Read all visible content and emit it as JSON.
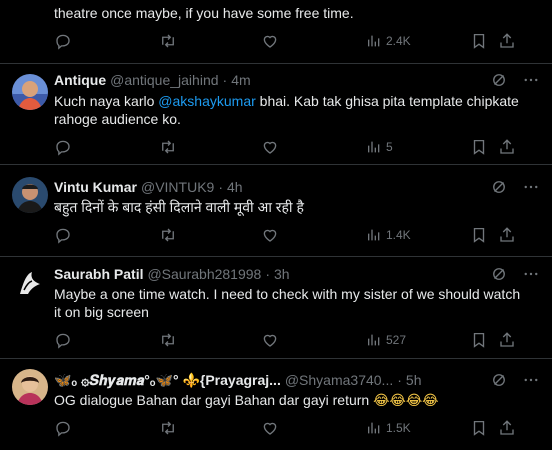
{
  "tweets": [
    {
      "text": "theatre once maybe, if you have some free time.",
      "views": "2.4K"
    },
    {
      "name": "Antique",
      "handle": "@antique_jaihind",
      "time": "4m",
      "text_pre": "Kuch naya karlo ",
      "mention": "@akshaykumar",
      "text_post": " bhai. Kab tak ghisa pita template chipkate",
      "text_line2": "rahoge audience ko.",
      "views": "5"
    },
    {
      "name": "Vintu Kumar",
      "handle": "@VINTUK9",
      "time": "4h",
      "text": "बहुत दिनों के बाद हंसी दिलाने वाली मूवी आ रही है",
      "views": "1.4K"
    },
    {
      "name": "Saurabh Patil",
      "handle": "@Saurabh281998",
      "time": "3h",
      "text_line1": "Maybe a one time watch. I need to check with my sister of we should watch",
      "text_line2": "it on big screen",
      "views": "527"
    },
    {
      "name": "🦋ₒ ۞𝑺𝒉𝒚𝒂𝒎𝒂°ₒ🦋°  ⚜️{Prayagraj...",
      "handle": "@Shyama3740...",
      "time": "5h",
      "text": "OG dialogue Bahan dar gayi Bahan dar gayi return",
      "emojis": "😂😂😂😂",
      "views": "1.5K"
    }
  ],
  "icons": {
    "reply": "reply-icon",
    "retweet": "retweet-icon",
    "like": "heart-icon",
    "views": "views-icon",
    "bookmark": "bookmark-icon",
    "share": "share-icon",
    "grok": "grok-icon",
    "more": "more-icon"
  },
  "colors": {
    "background": "#000000",
    "text": "#e7e9ea",
    "secondary": "#71767b",
    "mention": "#1d9bf0",
    "divider": "#2f3336"
  }
}
